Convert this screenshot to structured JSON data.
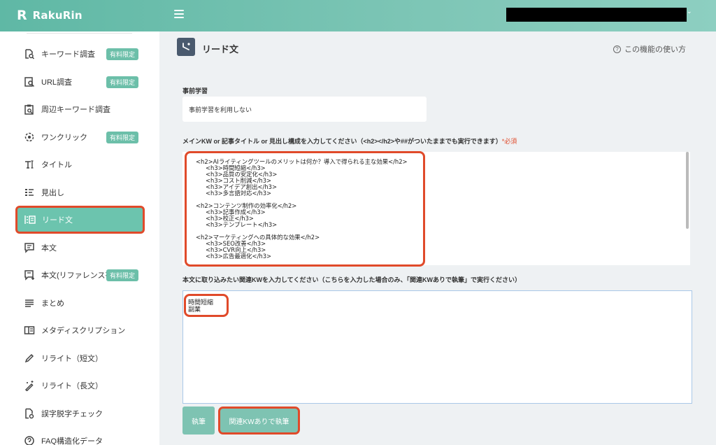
{
  "app": {
    "logo_mark": "R",
    "logo_text": "RakuRin"
  },
  "sidebar": {
    "items": [
      {
        "label": "キーワード調査",
        "icon": "search-doc-icon",
        "badge": "有料限定"
      },
      {
        "label": "URL調査",
        "icon": "url-search-icon",
        "badge": "有料限定"
      },
      {
        "label": "周辺キーワード調査",
        "icon": "clipboard-search-icon",
        "badge": ""
      },
      {
        "label": "ワンクリック",
        "icon": "one-click-icon",
        "badge": "有料限定"
      },
      {
        "label": "タイトル",
        "icon": "title-icon",
        "badge": ""
      },
      {
        "label": "見出し",
        "icon": "heading-list-icon",
        "badge": ""
      },
      {
        "label": "リード文",
        "icon": "lead-text-icon",
        "badge": "",
        "active": true
      },
      {
        "label": "本文",
        "icon": "body-text-icon",
        "badge": ""
      },
      {
        "label": "本文(リファレンス有)",
        "icon": "body-reference-icon",
        "badge": "有料限定"
      },
      {
        "label": "まとめ",
        "icon": "summary-lines-icon",
        "badge": ""
      },
      {
        "label": "メタディスクリプション",
        "icon": "meta-description-icon",
        "badge": ""
      },
      {
        "label": "リライト（短文）",
        "icon": "pencil-icon",
        "badge": ""
      },
      {
        "label": "リライト（長文）",
        "icon": "magic-pencil-icon",
        "badge": ""
      },
      {
        "label": "誤字脱字チェック",
        "icon": "doc-check-icon",
        "badge": ""
      },
      {
        "label": "FAQ構造化データ",
        "icon": "faq-icon",
        "badge": ""
      }
    ]
  },
  "main": {
    "page_title": "リード文",
    "help_label": "この機能の使い方",
    "pre_learning": {
      "label": "事前学習",
      "value": "事前学習を利用しない"
    },
    "main_kw": {
      "label": "メインKW or 記事タイトル or 見出し構成を入力してください（<h2></h2>や##がついたままでも実行できます）",
      "required": "*必須",
      "lines": [
        {
          "text": "<h2>AIライティングツールのメリットは何か？導入で得られる主な効果</h2>",
          "indent": false
        },
        {
          "text": "<h3>時間短縮</h3>",
          "indent": true
        },
        {
          "text": "<h3>品質の安定化</h3>",
          "indent": true
        },
        {
          "text": "<h3>コスト削減</h3>",
          "indent": true
        },
        {
          "text": "<h3>アイデア創出</h3>",
          "indent": true
        },
        {
          "text": "<h3>多言語対応</h3>",
          "indent": true
        },
        {
          "text": "",
          "indent": false
        },
        {
          "text": "<h2>コンテンツ制作の効率化</h2>",
          "indent": false
        },
        {
          "text": "<h3>記事作成</h3>",
          "indent": true
        },
        {
          "text": "<h3>校正</h3>",
          "indent": true
        },
        {
          "text": "<h3>テンプレート</h3>",
          "indent": true
        },
        {
          "text": "",
          "indent": false
        },
        {
          "text": "<h2>マーケティングへの具体的な効果</h2>",
          "indent": false
        },
        {
          "text": "<h3>SEO改善</h3>",
          "indent": true
        },
        {
          "text": "<h3>CVR向上</h3>",
          "indent": true
        },
        {
          "text": "<h3>広告最適化</h3>",
          "indent": true
        }
      ]
    },
    "related_kw": {
      "label": "本文に取り込みたい関連KWを入力してください（こちらを入力した場合のみ、「関連KWありで執筆」で実行ください）",
      "lines": [
        "時間短縮",
        "副業"
      ]
    },
    "buttons": {
      "write": "執筆",
      "write_with_kw": "関連KWありで執筆"
    }
  },
  "colors": {
    "accent": "#6cc4ae",
    "highlight": "#e04a2a",
    "badge": "#6cbfa9"
  }
}
